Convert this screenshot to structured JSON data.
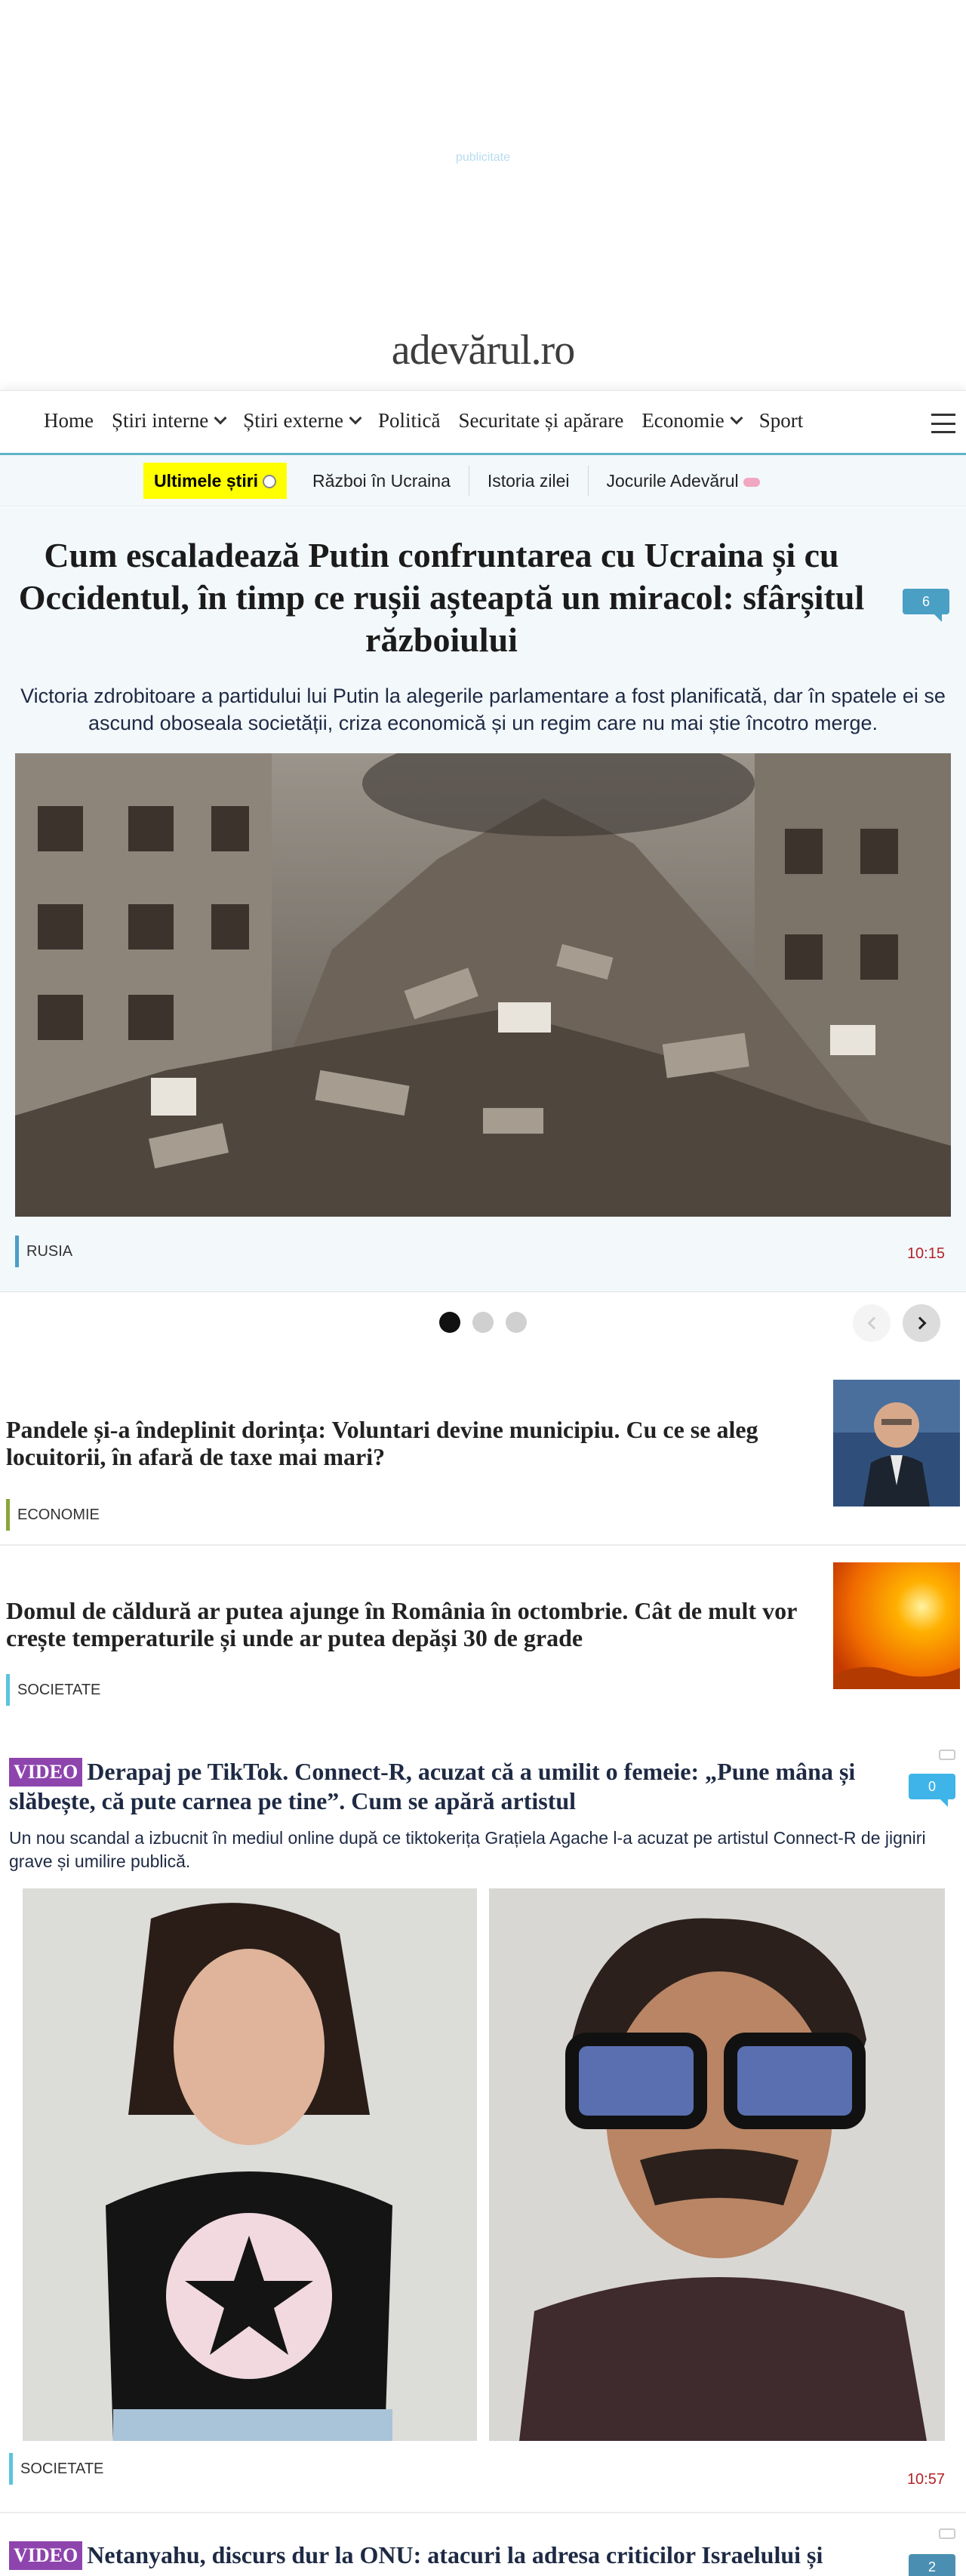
{
  "ad": {
    "label": "publicitate"
  },
  "site": {
    "logo": "adevărul.ro"
  },
  "nav": {
    "items": [
      {
        "label": "Home",
        "has_dropdown": false
      },
      {
        "label": "Știri interne",
        "has_dropdown": true
      },
      {
        "label": "Știri externe",
        "has_dropdown": true
      },
      {
        "label": "Politică",
        "has_dropdown": false
      },
      {
        "label": "Securitate și apărare",
        "has_dropdown": false
      },
      {
        "label": "Economie",
        "has_dropdown": true
      },
      {
        "label": "Sport",
        "has_dropdown": false
      }
    ],
    "menu_icon": "hamburger-icon"
  },
  "subnav": {
    "highlight": "Ultimele știri",
    "items": [
      "Război în Ucraina",
      "Istoria zilei",
      "Jocurile Adevărul"
    ]
  },
  "hero": {
    "title": "Cum escaladează Putin confruntarea cu Ucraina și cu Occidentul, în timp ce rușii așteaptă un miracol: sfârșitul războiului",
    "comments": "6",
    "lead": "Victoria zdrobitoare a partidului lui Putin la alegerile parlamentare a fost planificată, dar în spatele ei se ascund oboseala societății, criza economică și un regim care nu mai știe încotro merge.",
    "category": "RUSIA",
    "time": "10:15",
    "category_color": "#4a9fc4"
  },
  "carousel": {
    "dots": 3,
    "active": 0
  },
  "articles": [
    {
      "title": "Pandele și-a îndeplinit dorința: Voluntari devine municipiu. Cu ce se aleg locuitorii, în afară de taxe mai mari?",
      "category": "ECONOMIE",
      "category_color": "#8aa63c"
    },
    {
      "title": "Domul de căldură ar putea ajunge în România în octombrie. Cât de mult vor crește temperaturile și unde ar putea depăși 30 de grade",
      "category": "SOCIETATE",
      "category_color": "#5bc4de"
    }
  ],
  "video_articles": [
    {
      "tag": "VIDEO",
      "title": "Derapaj pe TikTok. Connect-R, acuzat că a umilit o femeie: „Pune mâna și slăbește, că pute carnea pe tine”. Cum se apără artistul",
      "comments": "0",
      "lead": "Un nou scandal a izbucnit în mediul online după ce tiktokerița Grațiela Agache l-a acuzat pe artistul Connect-R de jigniri grave și umilire publică.",
      "category": "SOCIETATE",
      "time": "10:57",
      "category_color": "#5bc4de"
    },
    {
      "tag": "VIDEO",
      "title": "Netanyahu, discurs dur la ONU: atacuri la adresa criticilor Israelului și",
      "comments": "2"
    }
  ]
}
